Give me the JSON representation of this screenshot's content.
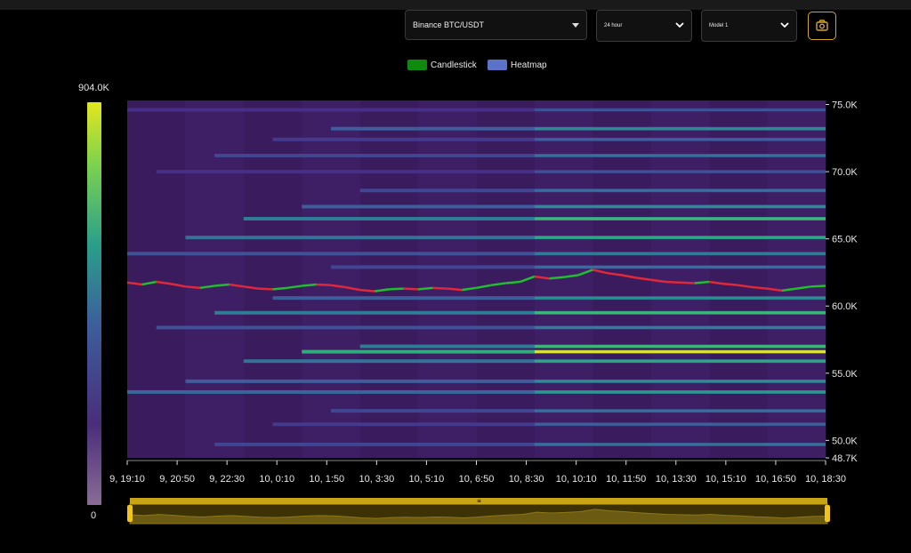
{
  "controls": {
    "exchange_pair": "Binance BTC/USDT",
    "time_range": "24 hour",
    "model": "Model 1",
    "camera_icon": "camera-icon"
  },
  "legend": [
    {
      "label": "Candlestick",
      "color": "#0f8a0f"
    },
    {
      "label": "Heatmap",
      "color": "#5b72c9"
    }
  ],
  "colorbar": {
    "max_label": "904.0K",
    "min_label": "0"
  },
  "chart_data": {
    "type": "heatmap",
    "title": "",
    "xlabel": "",
    "ylabel": "",
    "x_tick_labels": [
      "9, 19:10",
      "9, 20:50",
      "9, 22:30",
      "10, 0:10",
      "10, 1:50",
      "10, 3:30",
      "10, 5:10",
      "10, 6:50",
      "10, 8:30",
      "10, 10:10",
      "10, 11:50",
      "10, 13:30",
      "10, 15:10",
      "10, 16:50",
      "10, 18:30"
    ],
    "y_tick_labels": [
      "75.0K",
      "70.0K",
      "65.0K",
      "60.0K",
      "55.0K",
      "50.0K",
      "48.7K"
    ],
    "y_ticks": [
      75000,
      70000,
      65000,
      60000,
      55000,
      50000,
      48700
    ],
    "ylim": [
      48700,
      75300
    ],
    "x_hours": [
      0,
      24
    ],
    "colorscale": [
      "#2b0838",
      "#3b1661",
      "#453089",
      "#3e5a9c",
      "#2e7f94",
      "#24a386",
      "#4ec36b",
      "#aedc3a",
      "#fde725"
    ],
    "z_range": [
      0,
      904000
    ],
    "price_series": [
      {
        "t": 0.0,
        "p": 61750
      },
      {
        "t": 0.5,
        "p": 61600
      },
      {
        "t": 1.0,
        "p": 61800
      },
      {
        "t": 1.5,
        "p": 61650
      },
      {
        "t": 2.0,
        "p": 61450
      },
      {
        "t": 2.5,
        "p": 61350
      },
      {
        "t": 3.0,
        "p": 61500
      },
      {
        "t": 3.5,
        "p": 61600
      },
      {
        "t": 4.0,
        "p": 61450
      },
      {
        "t": 4.5,
        "p": 61300
      },
      {
        "t": 5.0,
        "p": 61250
      },
      {
        "t": 5.5,
        "p": 61350
      },
      {
        "t": 6.0,
        "p": 61500
      },
      {
        "t": 6.5,
        "p": 61600
      },
      {
        "t": 7.0,
        "p": 61550
      },
      {
        "t": 7.5,
        "p": 61400
      },
      {
        "t": 8.0,
        "p": 61200
      },
      {
        "t": 8.5,
        "p": 61100
      },
      {
        "t": 9.0,
        "p": 61250
      },
      {
        "t": 9.5,
        "p": 61300
      },
      {
        "t": 10.0,
        "p": 61250
      },
      {
        "t": 10.5,
        "p": 61350
      },
      {
        "t": 11.0,
        "p": 61300
      },
      {
        "t": 11.5,
        "p": 61200
      },
      {
        "t": 12.0,
        "p": 61350
      },
      {
        "t": 12.5,
        "p": 61550
      },
      {
        "t": 13.0,
        "p": 61700
      },
      {
        "t": 13.5,
        "p": 61800
      },
      {
        "t": 14.0,
        "p": 62200
      },
      {
        "t": 14.5,
        "p": 62050
      },
      {
        "t": 15.0,
        "p": 62150
      },
      {
        "t": 15.5,
        "p": 62300
      },
      {
        "t": 16.0,
        "p": 62700
      },
      {
        "t": 16.5,
        "p": 62450
      },
      {
        "t": 17.0,
        "p": 62300
      },
      {
        "t": 17.5,
        "p": 62100
      },
      {
        "t": 18.0,
        "p": 61950
      },
      {
        "t": 18.5,
        "p": 61800
      },
      {
        "t": 19.0,
        "p": 61750
      },
      {
        "t": 19.5,
        "p": 61700
      },
      {
        "t": 20.0,
        "p": 61800
      },
      {
        "t": 20.5,
        "p": 61650
      },
      {
        "t": 21.0,
        "p": 61550
      },
      {
        "t": 21.5,
        "p": 61400
      },
      {
        "t": 22.0,
        "p": 61300
      },
      {
        "t": 22.5,
        "p": 61150
      },
      {
        "t": 23.0,
        "p": 61300
      },
      {
        "t": 23.5,
        "p": 61450
      },
      {
        "t": 24.0,
        "p": 61500
      }
    ],
    "liquidity_bands": [
      {
        "p": 74600,
        "v": 0.35
      },
      {
        "p": 73200,
        "v": 0.55
      },
      {
        "p": 72400,
        "v": 0.4
      },
      {
        "p": 71200,
        "v": 0.45
      },
      {
        "p": 70000,
        "v": 0.35
      },
      {
        "p": 68600,
        "v": 0.45
      },
      {
        "p": 67400,
        "v": 0.55
      },
      {
        "p": 66500,
        "v": 0.7
      },
      {
        "p": 65100,
        "v": 0.65
      },
      {
        "p": 63900,
        "v": 0.5
      },
      {
        "p": 62900,
        "v": 0.45
      },
      {
        "p": 60600,
        "v": 0.55
      },
      {
        "p": 59500,
        "v": 0.7
      },
      {
        "p": 58400,
        "v": 0.5
      },
      {
        "p": 57000,
        "v": 0.7
      },
      {
        "p": 56600,
        "v": 0.95
      },
      {
        "p": 55900,
        "v": 0.65
      },
      {
        "p": 54400,
        "v": 0.55
      },
      {
        "p": 53600,
        "v": 0.6
      },
      {
        "p": 52200,
        "v": 0.45
      },
      {
        "p": 51200,
        "v": 0.4
      },
      {
        "p": 49700,
        "v": 0.45
      }
    ]
  }
}
